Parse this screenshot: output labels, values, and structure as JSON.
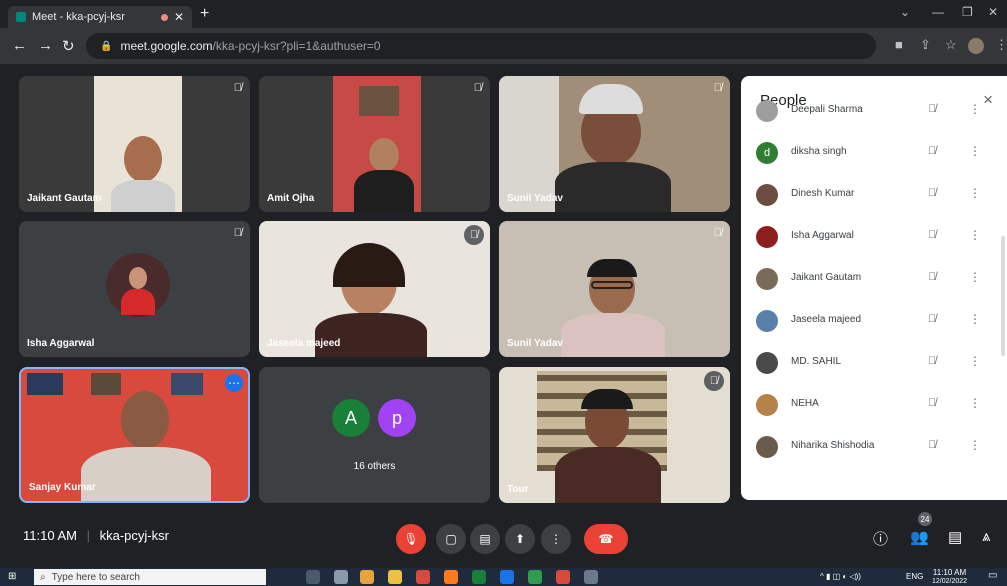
{
  "browser": {
    "tab_title": "Meet - kka-pcyj-ksr",
    "url_host": "meet.google.com",
    "url_path": "/kka-pcyj-ksr?pli=1&authuser=0"
  },
  "tiles": [
    {
      "name": "Jaikant Gautam"
    },
    {
      "name": "Amit Ojha"
    },
    {
      "name": "Sunil Yadav"
    },
    {
      "name": "Isha Aggarwal"
    },
    {
      "name": "Jaseela majeed"
    },
    {
      "name": "Sunil Yadav"
    },
    {
      "name": "Sanjay Kumar"
    },
    {
      "name": "16 others",
      "avatars": [
        "A",
        "p"
      ]
    },
    {
      "name": "Tour"
    }
  ],
  "bottom": {
    "time": "11:10 AM",
    "separator": "|",
    "meeting_code": "kka-pcyj-ksr",
    "participant_count": "24"
  },
  "people_panel": {
    "title": "People",
    "close": "×",
    "participants": [
      {
        "name": "Deepali Sharma",
        "initial": "",
        "color": "#9e9e9e"
      },
      {
        "name": "diksha singh",
        "initial": "d",
        "color": "#2e7d32"
      },
      {
        "name": "Dinesh Kumar",
        "initial": "",
        "color": "#6d4c41"
      },
      {
        "name": "Isha Aggarwal",
        "initial": "",
        "color": "#8d1e1e"
      },
      {
        "name": "Jaikant Gautam",
        "initial": "",
        "color": "#7a6a5a"
      },
      {
        "name": "Jaseela majeed",
        "initial": "",
        "color": "#5a7fa8"
      },
      {
        "name": "MD. SAHIL",
        "initial": "",
        "color": "#4a4a4a"
      },
      {
        "name": "NEHA",
        "initial": "",
        "color": "#b5834a"
      },
      {
        "name": "Niharika Shishodia",
        "initial": "",
        "color": "#6b5b4b"
      }
    ]
  },
  "taskbar": {
    "search_placeholder": "Type here to search",
    "lang": "ENG",
    "time": "11:10 AM",
    "date": "12/02/2022"
  }
}
